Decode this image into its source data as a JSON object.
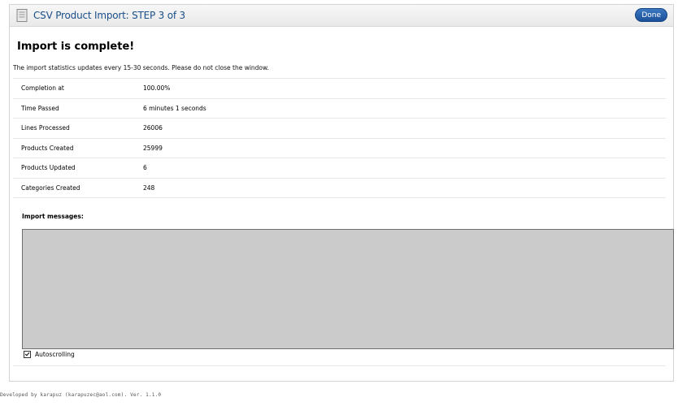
{
  "header": {
    "title": "CSV Product Import: STEP 3 of 3",
    "done_label": "Done"
  },
  "status": {
    "heading": "Import is complete!",
    "note": "The import statistics updates every 15-30 seconds. Please do not close the window."
  },
  "stats": [
    {
      "label": "Completion at",
      "value": "100.00%"
    },
    {
      "label": "Time Passed",
      "value": "6 minutes 1 seconds"
    },
    {
      "label": "Lines Processed",
      "value": "26006"
    },
    {
      "label": "Products Created",
      "value": "25999"
    },
    {
      "label": "Products Updated",
      "value": "6"
    },
    {
      "label": "Categories Created",
      "value": "248"
    }
  ],
  "messages": {
    "title": "Import messages:",
    "autoscroll_label": "Autoscrolling",
    "autoscroll_checked": true
  },
  "footer": {
    "text": "Developed by karapuz (karapuzec@aol.com). Ver. 1.1.0"
  },
  "colors": {
    "title": "#1a4f8a",
    "done_button": "#1c519a",
    "messages_bg": "#cbcbcb"
  },
  "icons": {
    "header_icon": "document-icon"
  }
}
